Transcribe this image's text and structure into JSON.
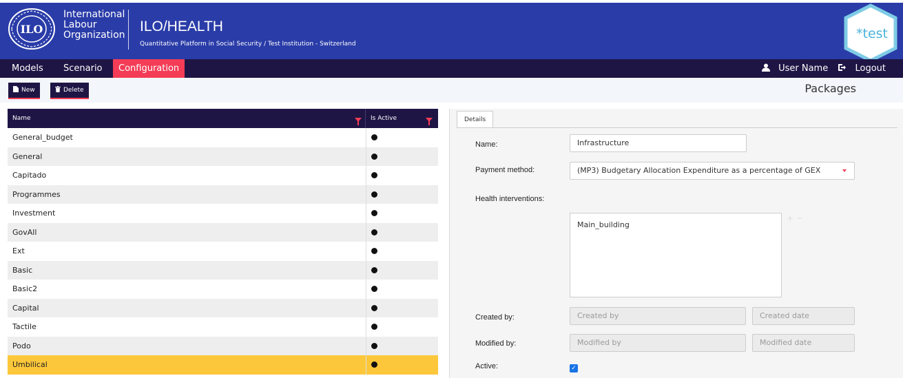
{
  "header": {
    "org_name": [
      "International",
      "Labour",
      "Organization"
    ],
    "emblem_text": "ILO",
    "app_title": "ILO/HEALTH",
    "app_subtitle": "Quantitative Platform in Social Security / Test Institution - Switzerland",
    "env_badge": "*test"
  },
  "nav": {
    "items": [
      {
        "label": "Models",
        "active": false
      },
      {
        "label": "Scenario",
        "active": false
      },
      {
        "label": "Configuration",
        "active": true
      }
    ],
    "user_name": "User Name",
    "logout_label": "Logout"
  },
  "toolbar": {
    "new_label": "New",
    "delete_label": "Delete",
    "page_title": "Packages"
  },
  "grid": {
    "columns": [
      "Name",
      "Is Active"
    ],
    "rows": [
      {
        "name": "General_budget",
        "active": true
      },
      {
        "name": "General",
        "active": true
      },
      {
        "name": "Capitado",
        "active": true
      },
      {
        "name": "Programmes",
        "active": true
      },
      {
        "name": "Investment",
        "active": true
      },
      {
        "name": "GovAll",
        "active": true
      },
      {
        "name": "Ext",
        "active": true
      },
      {
        "name": "Basic",
        "active": true
      },
      {
        "name": "Basic2",
        "active": true
      },
      {
        "name": "Capital",
        "active": true
      },
      {
        "name": "Tactile",
        "active": true
      },
      {
        "name": "Podo",
        "active": true
      },
      {
        "name": "Umbilical",
        "active": true,
        "selected": true
      }
    ]
  },
  "details": {
    "tab_label": "Details",
    "name_label": "Name:",
    "name_value": "Infrastructure",
    "payment_label": "Payment method:",
    "payment_value": "(MP3) Budgetary Allocation Expenditure as a percentage of GEX",
    "interventions_label": "Health interventions:",
    "interventions": [
      "Main_building"
    ],
    "created_by_label": "Created by:",
    "created_by_placeholder": "Created by",
    "created_date_placeholder": "Created date",
    "modified_by_label": "Modified by:",
    "modified_by_placeholder": "Modified by",
    "modified_date_placeholder": "Modified date",
    "active_label": "Active:",
    "active_checked": true
  },
  "colors": {
    "header_bg": "#2a3ca8",
    "nav_bg": "#1f1545",
    "accent": "#f43c56",
    "selected_row": "#fcc73a"
  }
}
